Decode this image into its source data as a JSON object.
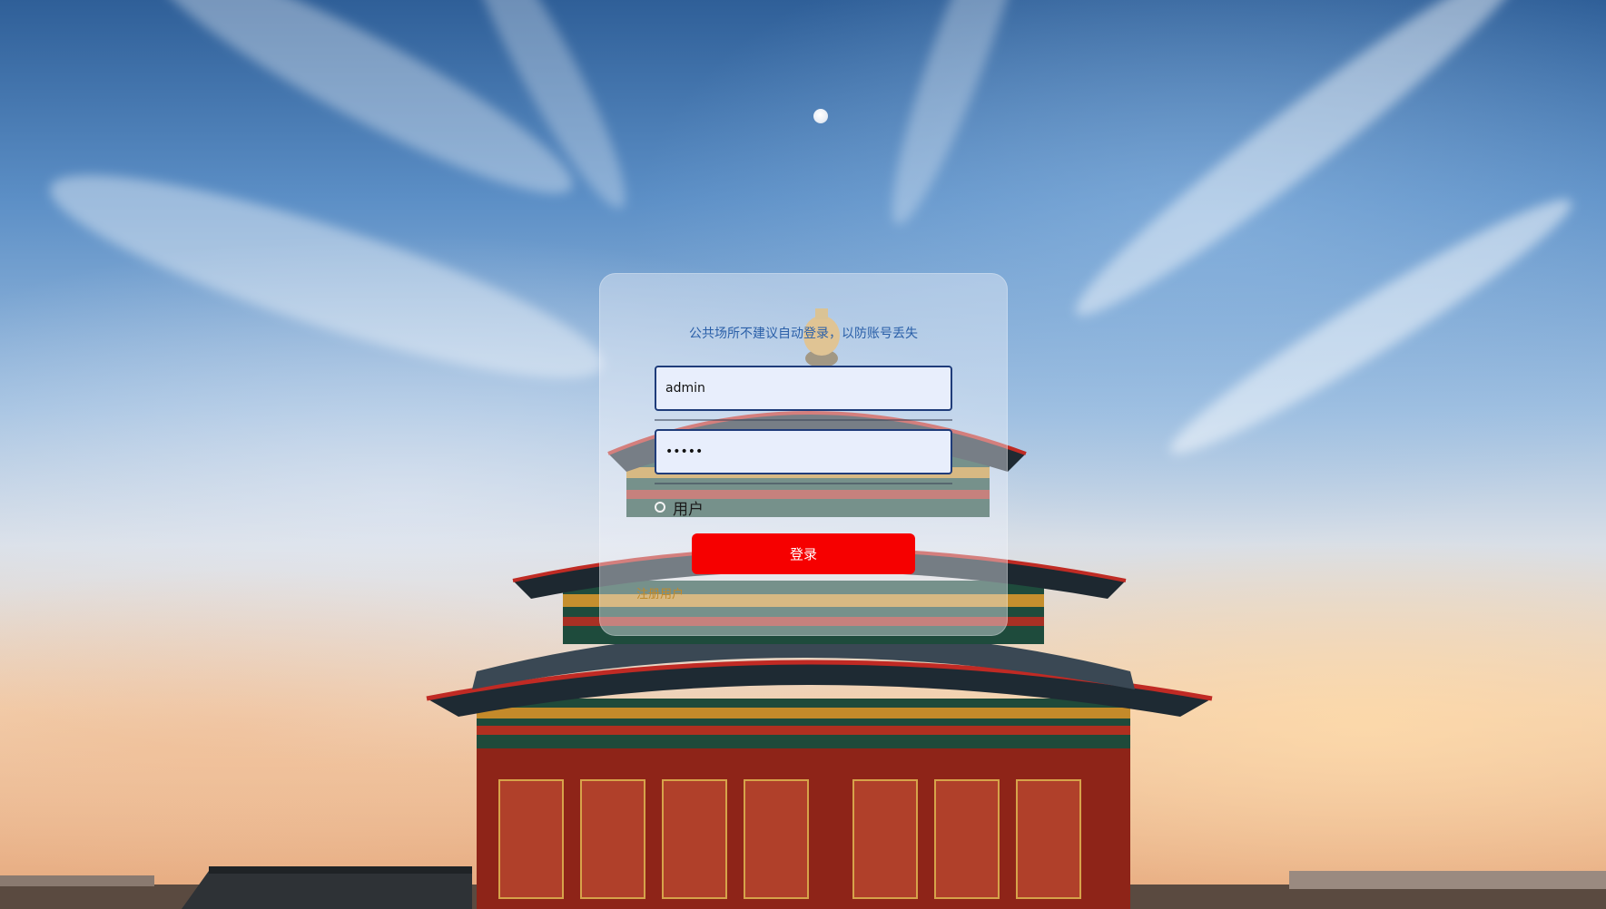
{
  "login": {
    "notice": "公共场所不建议自动登录，以防账号丢失",
    "username_value": "admin",
    "password_value": "•••••",
    "role_option_label": "用户",
    "submit_label": "登录",
    "register_link": "注册用户"
  },
  "colors": {
    "notice_text": "#2a5fa8",
    "button_bg": "#f60000",
    "input_border": "#1f3c7a",
    "register_text": "#c08a2a"
  },
  "icons": {
    "radio": "radio-unchecked-icon",
    "moon": "moon-icon"
  }
}
